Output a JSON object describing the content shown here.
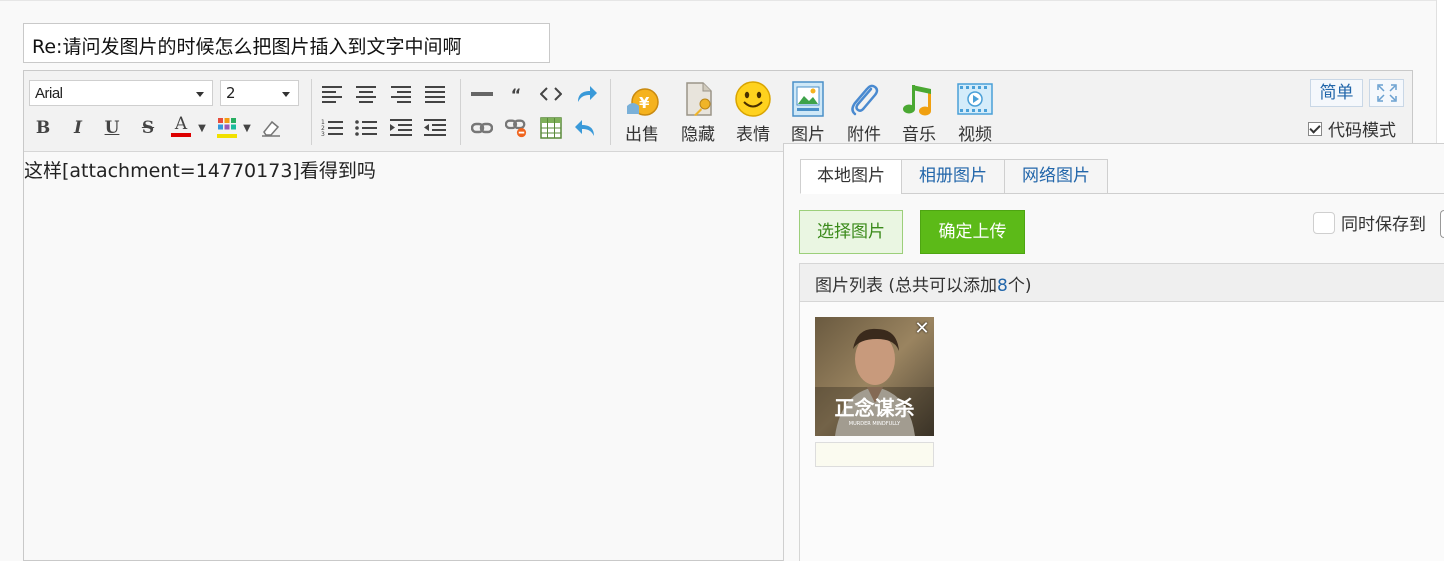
{
  "subject": {
    "value": "Re:请问发图片的时候怎么把图片插入到文字中间啊"
  },
  "toolbar": {
    "font_family": "Arial",
    "font_size": "2",
    "big_buttons": [
      {
        "label": "出售"
      },
      {
        "label": "隐藏"
      },
      {
        "label": "表情"
      },
      {
        "label": "图片"
      },
      {
        "label": "附件"
      },
      {
        "label": "音乐"
      },
      {
        "label": "视频"
      }
    ],
    "simple_mode_label": "简单",
    "code_mode_label": "代码模式",
    "code_mode_checked": true
  },
  "editor": {
    "content": "这样[attachment=14770173]看得到吗"
  },
  "image_panel": {
    "tabs": [
      "本地图片",
      "相册图片",
      "网络图片"
    ],
    "select_button": "选择图片",
    "upload_button": "确定上传",
    "save_option_label": "同时保存到",
    "list_header_prefix": "图片列表 (总共可以添加",
    "list_header_count": "8",
    "list_header_suffix": "个)",
    "thumbnail_caption": "正念谋杀",
    "thumbnail_subcaption": "MURDER MINDFULLY",
    "thumbnail_desc_value": ""
  },
  "colors": {
    "upload_green": "#5cba18",
    "link_blue": "#2266aa",
    "font_color_red": "#dd0000"
  }
}
